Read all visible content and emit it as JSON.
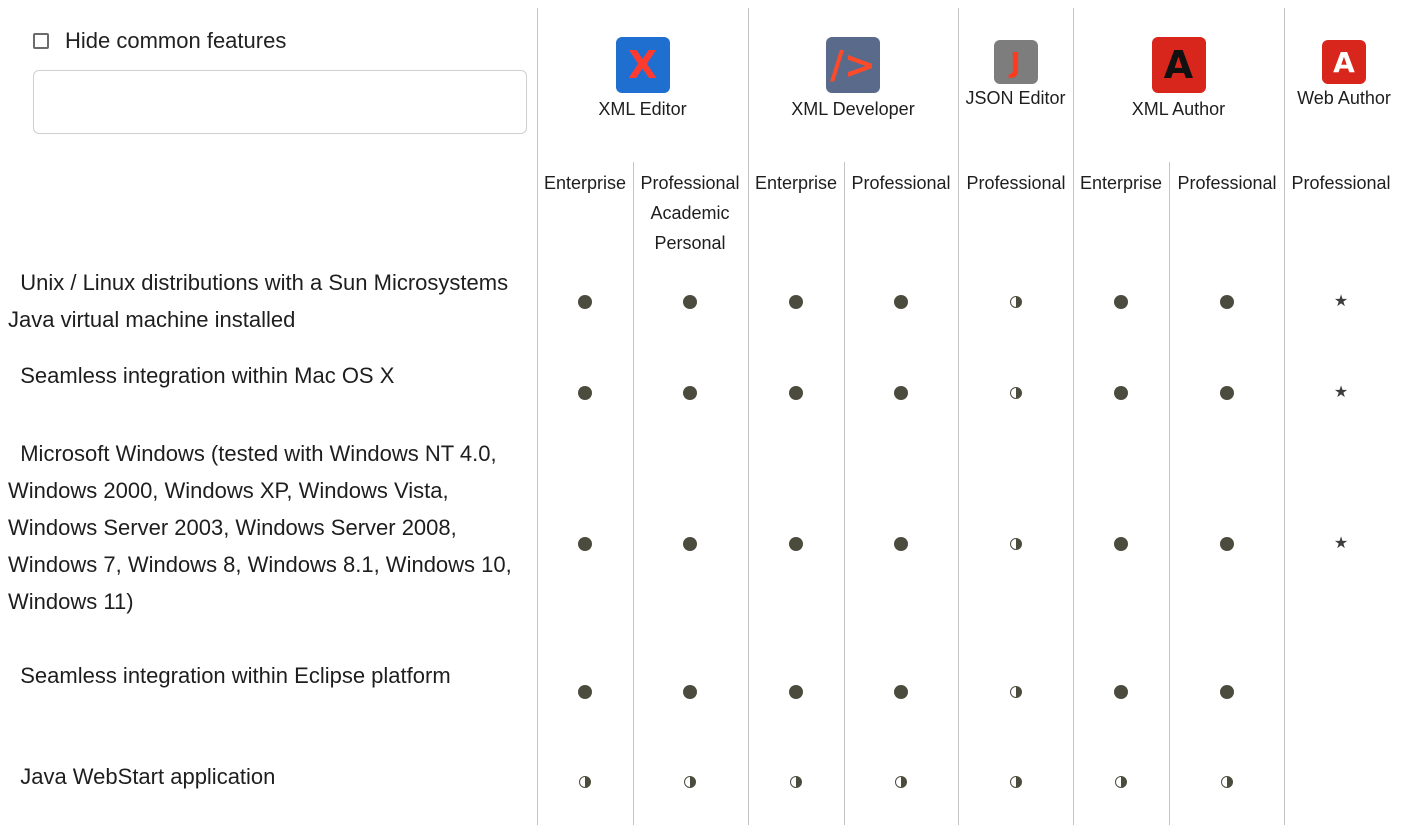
{
  "filter": {
    "hide_common_label": "Hide common features",
    "hide_common_checked": false,
    "search_value": "",
    "search_placeholder": ""
  },
  "products": [
    {
      "name": "XML Editor",
      "icon": "xml-editor-icon",
      "color": "#1f6fd1",
      "glyph": "X",
      "glyph_color": "#ff3b30"
    },
    {
      "name": "XML Developer",
      "icon": "xml-developer-icon",
      "color": "#5a6a8a",
      "glyph": "/>",
      "glyph_color": "#ff4a2a"
    },
    {
      "name": "JSON Editor",
      "icon": "json-editor-icon",
      "color": "#7d7d7d",
      "glyph": "J",
      "glyph_color": "#ff3b1f"
    },
    {
      "name": "XML Author",
      "icon": "xml-author-icon",
      "color": "#d9261c",
      "glyph": "A",
      "glyph_color": "#111111"
    },
    {
      "name": "Web Author",
      "icon": "web-author-icon",
      "color": "#d9261c",
      "glyph": "A",
      "glyph_color": "#ffffff"
    }
  ],
  "editions": [
    "Enterprise",
    "Professional\nAcademic\nPersonal",
    "Enterprise",
    "Professional",
    "Professional",
    "Enterprise",
    "Professional",
    "Professional"
  ],
  "features": [
    {
      "label": "Unix / Linux distributions with a Sun Microsystems Java virtual machine installed",
      "support": [
        "full",
        "full",
        "full",
        "full",
        "partial",
        "full",
        "full",
        "star"
      ]
    },
    {
      "label": "Seamless integration within Mac OS X",
      "support": [
        "full",
        "full",
        "full",
        "full",
        "partial",
        "full",
        "full",
        "star"
      ]
    },
    {
      "label": "Microsoft Windows (tested with Windows NT 4.0, Windows 2000, Windows XP, Windows Vista, Windows Server 2003, Windows Server 2008, Windows 7, Windows 8, Windows 8.1, Windows 10, Windows 11)",
      "support": [
        "full",
        "full",
        "full",
        "full",
        "partial",
        "full",
        "full",
        "star"
      ]
    },
    {
      "label": "Seamless integration within Eclipse platform",
      "support": [
        "full",
        "full",
        "full",
        "full",
        "partial",
        "full",
        "full",
        "none"
      ]
    },
    {
      "label": "Java WebStart application",
      "support": [
        "partial",
        "partial",
        "partial",
        "partial",
        "partial",
        "partial",
        "partial",
        "none"
      ]
    }
  ],
  "legend_icons": {
    "full": "full-support-dot-icon",
    "partial": "partial-support-icon",
    "star": "star-icon"
  }
}
